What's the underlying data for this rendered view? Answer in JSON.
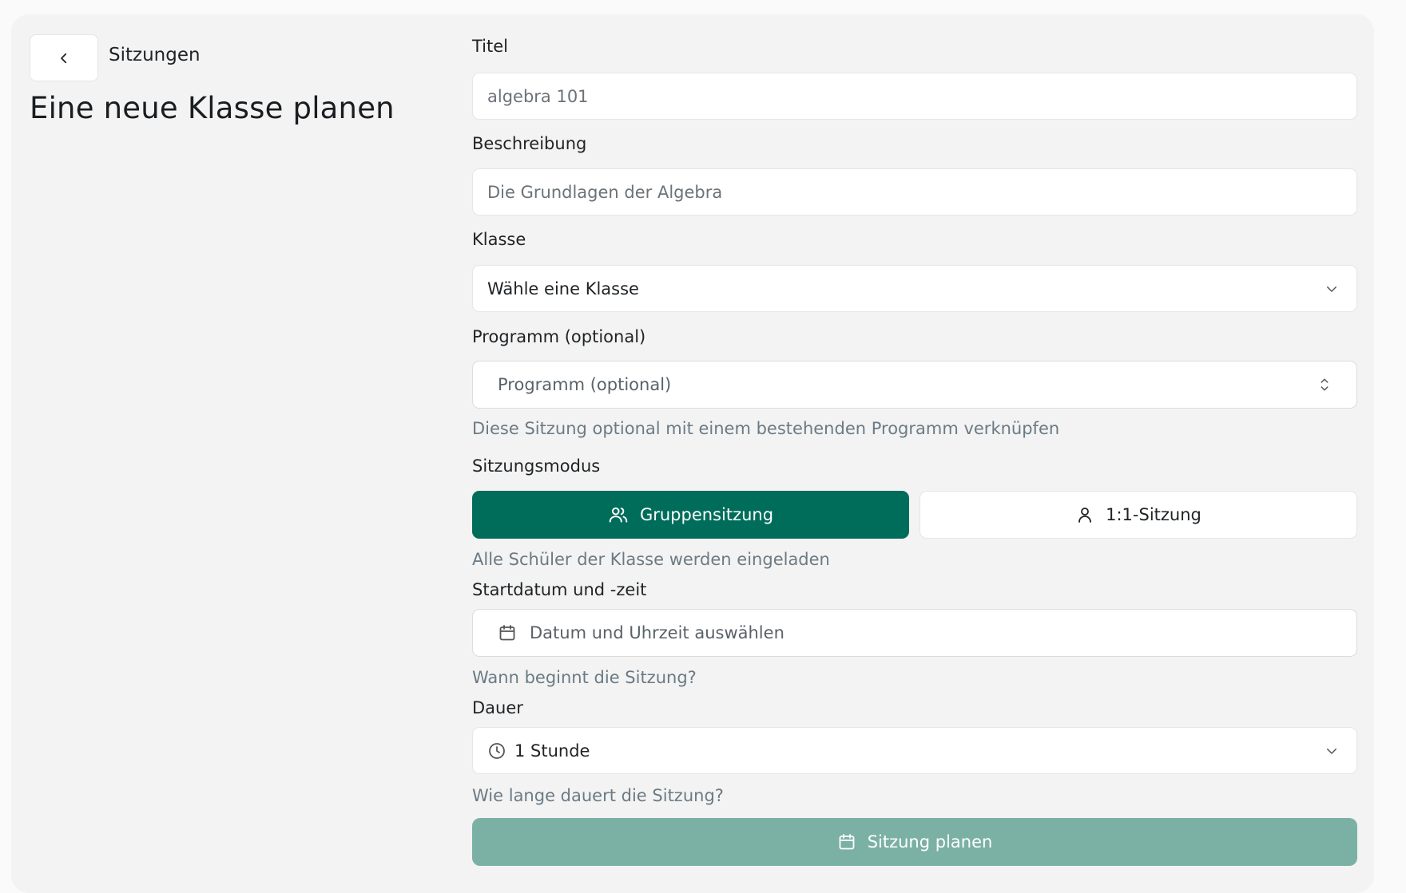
{
  "header": {
    "breadcrumb": "Sitzungen",
    "title": "Eine neue Klasse planen"
  },
  "form": {
    "title": {
      "label": "Titel",
      "placeholder": "algebra 101"
    },
    "description": {
      "label": "Beschreibung",
      "placeholder": "Die Grundlagen der Algebra"
    },
    "class": {
      "label": "Klasse",
      "value": "Wähle eine Klasse"
    },
    "program": {
      "label": "Programm (optional)",
      "placeholder": "Programm (optional)",
      "hint": "Diese Sitzung optional mit einem bestehenden Programm verknüpfen"
    },
    "mode": {
      "label": "Sitzungsmodus",
      "options": [
        {
          "label": "Gruppensitzung",
          "icon": "users-icon",
          "selected": true
        },
        {
          "label": "1:1-Sitzung",
          "icon": "user-icon",
          "selected": false
        }
      ],
      "hint": "Alle Schüler der Klasse werden eingeladen"
    },
    "start": {
      "label": "Startdatum und -zeit",
      "placeholder": "Datum und Uhrzeit auswählen",
      "hint": "Wann beginnt die Sitzung?"
    },
    "duration": {
      "label": "Dauer",
      "value": "1 Stunde",
      "hint": "Wie lange dauert die Sitzung?"
    },
    "submit_label": "Sitzung planen"
  },
  "colors": {
    "primary": "#006d5b",
    "primary_disabled": "#7bb1a5",
    "background": "#f3f3f3"
  }
}
